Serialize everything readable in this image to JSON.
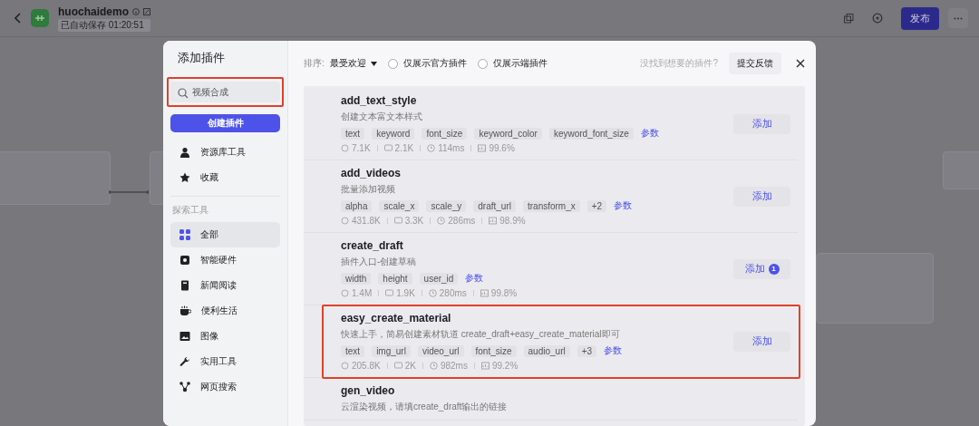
{
  "topbar": {
    "title": "huochaidemo",
    "subtitle": "已自动保存 01:20:51",
    "publish": "发布"
  },
  "modal": {
    "title": "添加插件",
    "search": {
      "value": "视频合成",
      "highlighted": true
    },
    "create_button": "创建插件",
    "nav": [
      {
        "label": "资源库工具",
        "selected": false
      },
      {
        "label": "收藏",
        "selected": false
      }
    ],
    "section_label": "探索工具",
    "categories": [
      {
        "label": "全部",
        "selected": true
      },
      {
        "label": "智能硬件",
        "selected": false
      },
      {
        "label": "新闻阅读",
        "selected": false
      },
      {
        "label": "便利生活",
        "selected": false
      },
      {
        "label": "图像",
        "selected": false
      },
      {
        "label": "实用工具",
        "selected": false
      },
      {
        "label": "网页搜索",
        "selected": false
      }
    ],
    "sort_label": "排序:",
    "sort_value": "最受欢迎",
    "filters": [
      {
        "label": "仅展示官方插件",
        "checked": false
      },
      {
        "label": "仅展示端插件",
        "checked": false
      }
    ],
    "feedback_hint": "没找到想要的插件?",
    "feedback_button": "提交反馈",
    "plugins": [
      {
        "name": "add_text_style",
        "description": "创建文本富文本样式",
        "params": [
          "text",
          "keyword",
          "font_size",
          "keyword_color",
          "keyword_font_size"
        ],
        "params_link": "参数",
        "stats": [
          "7.1K",
          "2.1K",
          "114ms",
          "99.6%"
        ],
        "add": "添加",
        "highlighted": false
      },
      {
        "name": "add_videos",
        "description": "批量添加视频",
        "params": [
          "alpha",
          "scale_x",
          "scale_y",
          "draft_url",
          "transform_x",
          "+2"
        ],
        "params_link": "参数",
        "stats": [
          "431.8K",
          "3.3K",
          "286ms",
          "98.9%"
        ],
        "add": "添加",
        "highlighted": false
      },
      {
        "name": "create_draft",
        "description": "插件入口-创建草稿",
        "params": [
          "width",
          "height",
          "user_id"
        ],
        "params_link": "参数",
        "stats": [
          "1.4M",
          "1.9K",
          "280ms",
          "99.8%"
        ],
        "add": "添加",
        "badge": "1",
        "highlighted": false
      },
      {
        "name": "easy_create_material",
        "description": "快速上手，简易创建素材轨道 create_draft+easy_create_material即可",
        "params": [
          "text",
          "img_url",
          "video_url",
          "font_size",
          "audio_url",
          "+3"
        ],
        "params_link": "参数",
        "stats": [
          "205.8K",
          "2K",
          "982ms",
          "99.2%"
        ],
        "add": "添加",
        "highlighted": true
      },
      {
        "name": "gen_video",
        "description": "云渲染视频，请填create_draft输出的链接",
        "highlighted": false
      }
    ]
  }
}
